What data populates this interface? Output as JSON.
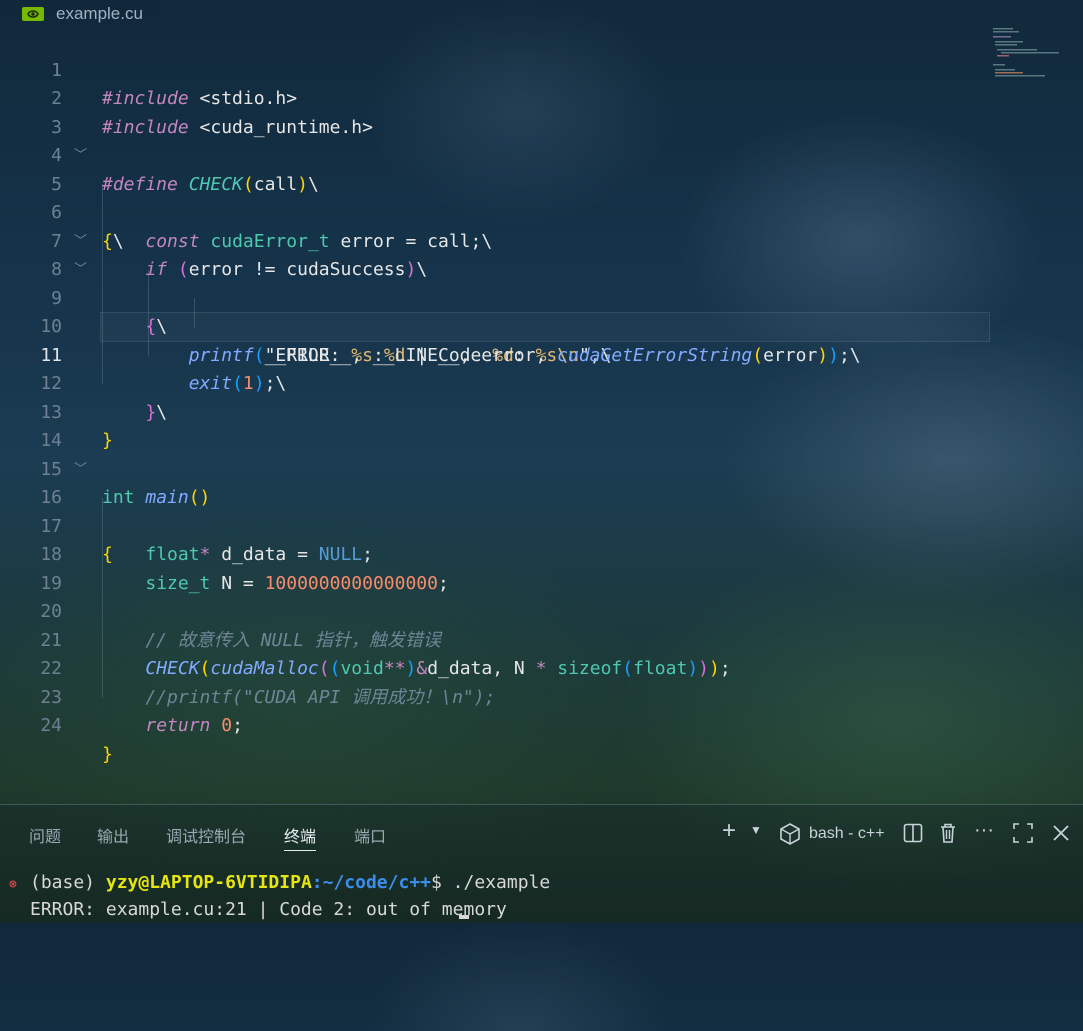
{
  "tab": {
    "filename": "example.cu",
    "icon": "nvidia-icon"
  },
  "editor": {
    "active_line": 11,
    "line_numbers": [
      "1",
      "2",
      "3",
      "4",
      "5",
      "6",
      "7",
      "8",
      "9",
      "10",
      "11",
      "12",
      "13",
      "14",
      "15",
      "16",
      "17",
      "18",
      "19",
      "20",
      "21",
      "22",
      "23",
      "24"
    ],
    "lines": [
      "#include <stdio.h>",
      "#include <cuda_runtime.h>",
      "",
      "#define CHECK(call)\\",
      "{\\",
      "    const cudaError_t error = call;\\",
      "    if (error != cudaSuccess)\\",
      "    {\\",
      "        printf(\"ERROR: %s:%d | Code %d: %s\\n\",\\",
      "               __FILE__, __LINE__, error, cudaGetErrorString(error));\\",
      "        exit(1);\\",
      "    }\\",
      "}",
      "",
      "int main()",
      "{",
      "    float* d_data = NULL;",
      "    size_t N = 1000000000000000;",
      "",
      "    // 故意传入 NULL 指针，触发错误",
      "    CHECK(cudaMalloc((void**)&d_data, N * sizeof(float)));",
      "    //printf(\"CUDA API 调用成功！\\n\");",
      "    return 0;",
      "}"
    ]
  },
  "panel": {
    "tabs": [
      "问题",
      "输出",
      "调试控制台",
      "终端",
      "端口"
    ],
    "active_tab": "终端",
    "terminal_name": "bash - c++",
    "terminal": {
      "prompt_env": "(base)",
      "prompt_user": "yzy@LAPTOP-6VTIDIPA",
      "prompt_path": ":~/code/c++",
      "prompt_symbol": "$",
      "command": " ./example",
      "output": "ERROR: example.cu:21 | Code 2: out of memory"
    }
  },
  "colors": {
    "keyword": "#c586c0",
    "type": "#4ec9b0",
    "function": "#82aaff",
    "number": "#f78c6c",
    "comment": "#6f8596",
    "bracket1": "#ffd700",
    "bracket2": "#da70d6",
    "bracket3": "#179fff",
    "terminal_user": "#e5e510",
    "terminal_path": "#3b8eea",
    "error": "#f14c4c"
  }
}
